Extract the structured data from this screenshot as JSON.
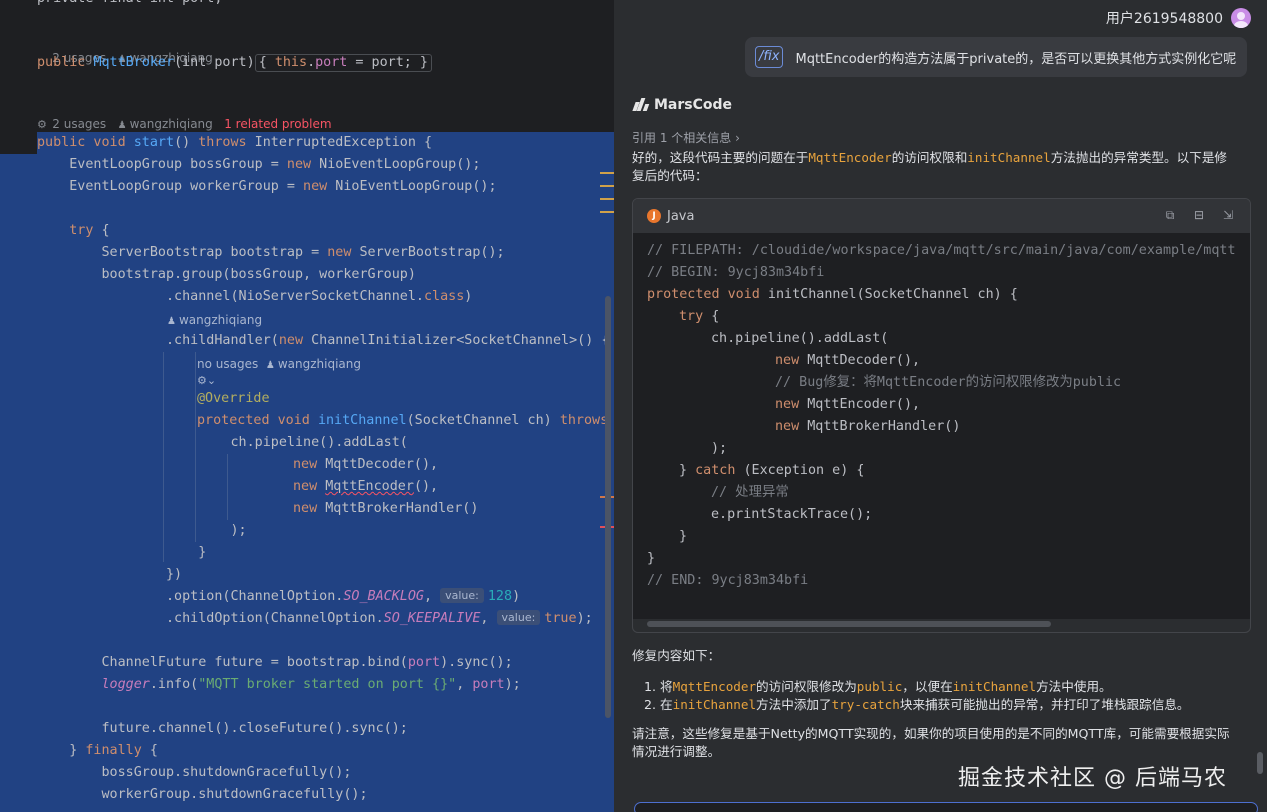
{
  "editor": {
    "line_top": "private final int port;",
    "usages_1": "2 usages",
    "author": "wangzhiqiang",
    "ctor_line": {
      "kw": "public",
      "name": "MqttBroker",
      "params": "(int port)",
      "body_kw": "this",
      "body_fld": "port",
      "body_rest": " = port;"
    },
    "usages_2": "2 usages",
    "problem": "1 related problem",
    "start_line": {
      "mod": "public void",
      "name": "start",
      "rest": "() ",
      "throws": "throws",
      "ex": " InterruptedException {"
    },
    "lines": {
      "boss": "    EventLoopGroup bossGroup = ",
      "boss_new": "new",
      "boss_rest": " NioEventLoopGroup();",
      "worker": "    EventLoopGroup workerGroup = ",
      "worker_new": "new",
      "worker_rest": " NioEventLoopGroup();",
      "try": "try",
      "sb": "        ServerBootstrap bootstrap = ",
      "sb_new": "new",
      "sb_rest": " ServerBootstrap();",
      "group": "        bootstrap.group(bossGroup, workerGroup)",
      "channel": "                .channel(NioServerSocketChannel.",
      "channel_cls": "class",
      "channel_end": ")",
      "child": "                .childHandler(",
      "child_new": "new",
      "child_rest": " ChannelInitializer<SocketChannel>() {",
      "no_usages": "no usages",
      "override": "@Override",
      "init_mod": "protected void",
      "init_name": "initChannel",
      "init_rest": "(SocketChannel ch) ",
      "init_throws": "throws",
      "pipeline": "                        ch.pipeline().addLast(",
      "new": "new",
      "dec": " MqttDecoder(),",
      "enc_pre": " ",
      "enc": "MqttEncoder",
      "enc_post": "(),",
      "handler": " MqttBrokerHandler()",
      "close_paren": "                        );",
      "close_brace1": "                    }",
      "close_brace2": "                })",
      "opt": "                .option(ChannelOption.",
      "opt_const": "SO_BACKLOG",
      "opt_comma": ", ",
      "hint_value": "value:",
      "opt_num": "128",
      "opt_end": ")",
      "copt": "                .childOption(ChannelOption.",
      "copt_const": "SO_KEEPALIVE",
      "copt_true": "true",
      "copt_end": ");",
      "future": "        ChannelFuture future = bootstrap.bind(",
      "future_port": "port",
      "future_end": ").sync();",
      "logger": "logger",
      "logger_mid": ".info(",
      "logger_str": "\"MQTT broker started on port {}\"",
      "logger_comma": ", ",
      "logger_port": "port",
      "logger_end": ");",
      "close_future": "        future.channel().closeFuture().sync();",
      "finally_pre": "    } ",
      "finally": "finally",
      "finally_post": " {",
      "shut1": "        bossGroup.shutdownGracefully();",
      "shut2": "        workerGroup.shutdownGracefully();"
    }
  },
  "chat": {
    "user": "用户2619548800",
    "fix_tag": "/fix",
    "question": "MqttEncoder的构造方法属于private的，是否可以更换其他方式实例化它呢",
    "assistant_name": "MarsCode",
    "ref": "引用 1 个相关信息 ›",
    "intro": {
      "p1": "好的，这段代码主要的问题在于",
      "c1": "MqttEncoder",
      "p2": "的访问权限和",
      "c2": "initChannel",
      "p3": "方法抛出的异常类型。以下是修",
      "p4": "复后的代码："
    },
    "code_lang": "Java",
    "code_lines": {
      "l1": "// FILEPATH: /cloudide/workspace/java/mqtt/src/main/java/com/example/mqtt",
      "l2": "// BEGIN: 9ycj83m34bfi",
      "l3_kw": "protected void",
      "l3_rest": " initChannel(SocketChannel ch) {",
      "l4": "try",
      "l4_end": " {",
      "l5": "ch.pipeline().addLast(",
      "new": "new",
      "l6": " MqttDecoder(),",
      "l7": "// Bug修复：将MqttEncoder的访问权限修改为public",
      "l8": " MqttEncoder(),",
      "l9": " MqttBrokerHandler()",
      "l10": ");",
      "l11_pre": "} ",
      "l11_kw": "catch",
      "l11_rest": " (Exception e) {",
      "l12": "// 处理异常",
      "l13": "e.printStackTrace();",
      "l14": "}",
      "l15": "}",
      "l16": "// END: 9ycj83m34bfi"
    },
    "summary_title": "修复内容如下：",
    "item1": {
      "n": "1. 将",
      "c1": "MqttEncoder",
      "t1": "的访问权限修改为",
      "c2": "public",
      "t2": "，以便在",
      "c3": "initChannel",
      "t3": "方法中使用。"
    },
    "item2": {
      "n": "2. 在",
      "c1": "initChannel",
      "t1": "方法中添加了",
      "c2": "try-catch",
      "t2": "块来捕获可能抛出的异常，并打印了堆栈跟踪信息。"
    },
    "note_1": "请注意，这些修复是基于Netty的MQTT实现的，如果你的项目使用的是不同的MQTT库，可能需要根据实际",
    "note_2": "情况进行调整。",
    "watermark": "掘金技术社区 @ 后端马农"
  },
  "colors": {
    "selection": "#214283",
    "keyword": "#cf8e6d",
    "function": "#56a8f5",
    "inline_code": "#e8a33d"
  }
}
